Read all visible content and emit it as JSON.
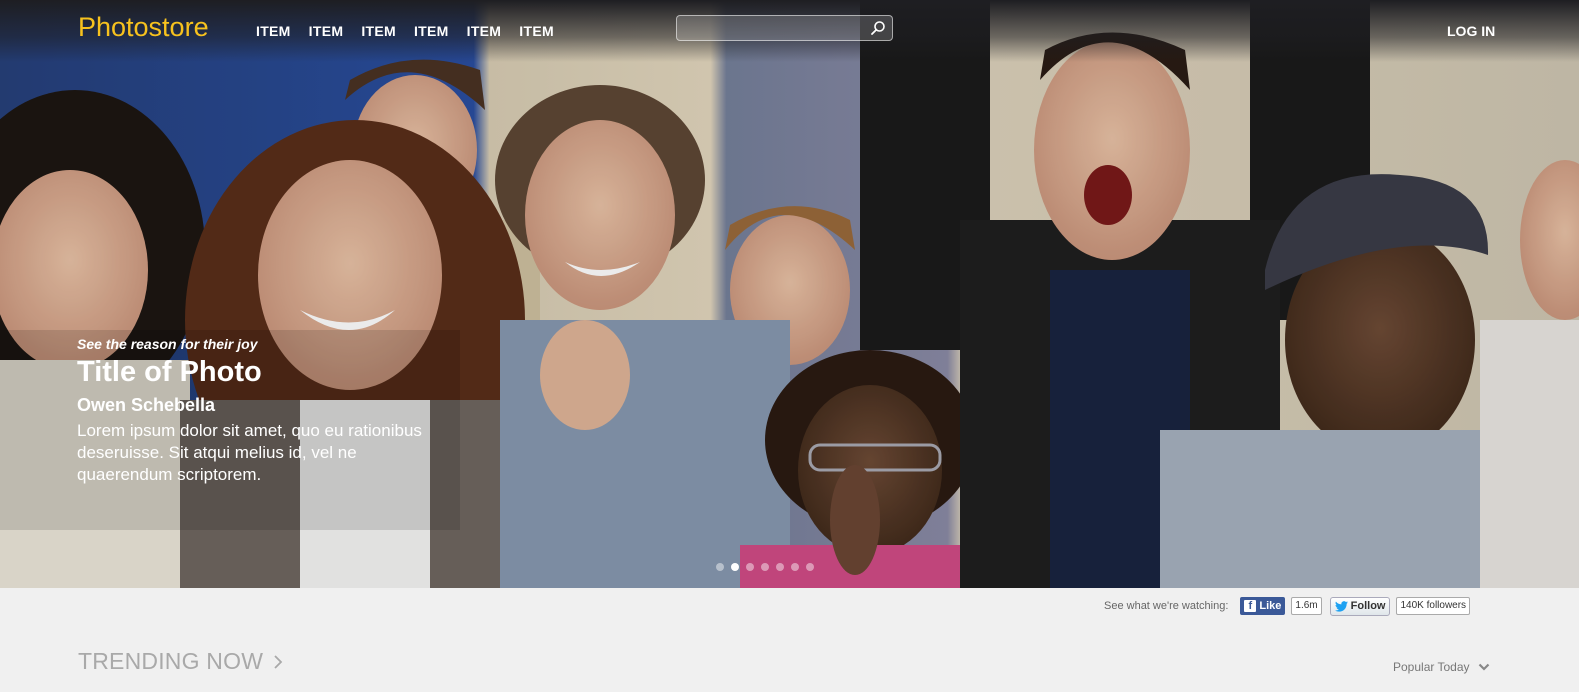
{
  "header": {
    "logo": "Photostore",
    "nav_items": [
      "ITEM",
      "ITEM",
      "ITEM",
      "ITEM",
      "ITEM",
      "ITEM"
    ],
    "search": {
      "value": "",
      "placeholder": ""
    },
    "login_label": "LOG IN"
  },
  "hero": {
    "tagline": "See the reason for their joy",
    "title": "Title of Photo",
    "photographer": "Owen Schebella",
    "description": "Lorem ipsum dolor sit amet, quo eu rationibus deseruisse. Sit atqui melius id, vel ne quaerendum scriptorem.",
    "slide_count": 7,
    "active_slide": 2
  },
  "social": {
    "label": "See what we're watching:",
    "facebook": {
      "label": "Like",
      "count": "1.6m"
    },
    "twitter": {
      "label": "Follow",
      "count": "140K followers"
    }
  },
  "trending": {
    "heading": "TRENDING NOW",
    "sort_label": "Popular Today"
  },
  "colors": {
    "logo": "#f7c21e",
    "facebook": "#3b5998",
    "twitter": "#1da1f2",
    "background": "#f0f0f0"
  },
  "icons": [
    "search-icon",
    "facebook-icon",
    "twitter-icon",
    "chevron-right-icon",
    "chevron-down-icon"
  ]
}
